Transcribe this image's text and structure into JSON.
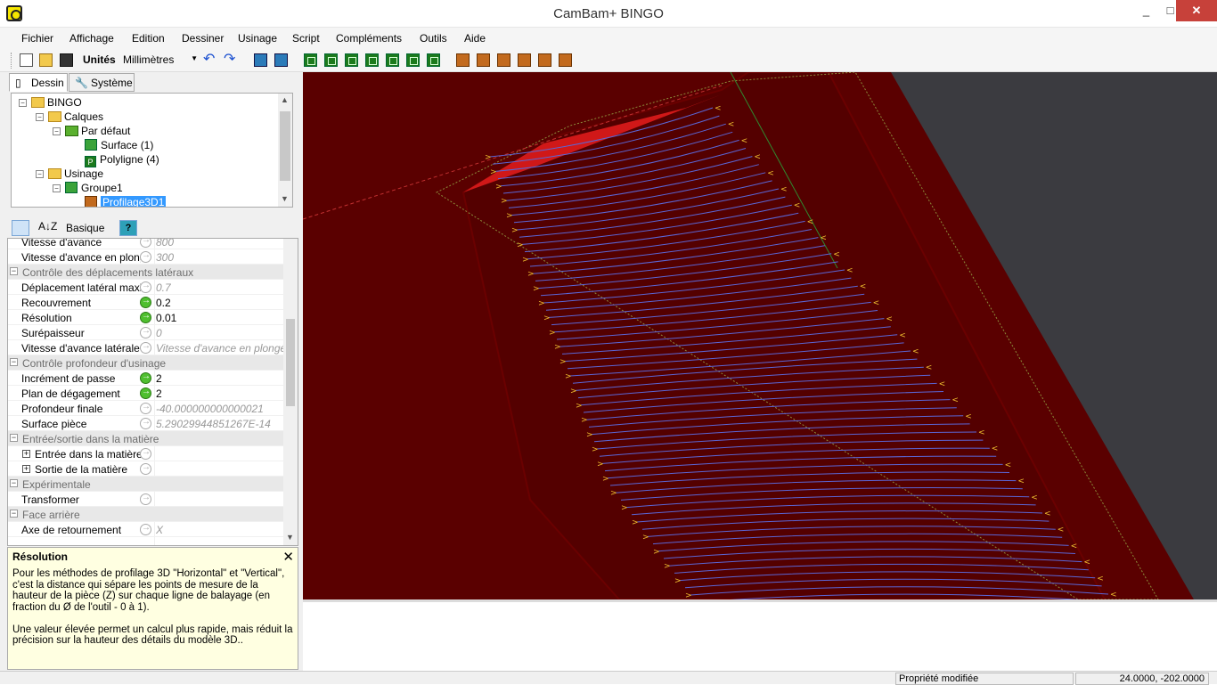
{
  "window": {
    "title": "CamBam+  BINGO",
    "minimize": "_",
    "maximize": "□",
    "close": "✕"
  },
  "menu": [
    "Fichier",
    "Affichage",
    "Edition",
    "Dessiner",
    "Usinage",
    "Script",
    "Compléments",
    "Outils",
    "Aide"
  ],
  "toolbar": {
    "units_label": "Unités",
    "units_value": "Millimètres",
    "icons": [
      "new-file-icon",
      "open-folder-icon",
      "save-icon",
      "undo-icon",
      "redo-icon",
      "snap-icon",
      "grid-icon",
      "profile-icon",
      "pocket-icon",
      "drill-icon",
      "engrave-icon",
      "text-icon",
      "lathe-icon",
      "3d-profile-icon",
      "gcode-icon",
      "style-icon",
      "script-icon",
      "export-icon",
      "post-icon"
    ]
  },
  "tabs": {
    "drawing": "Dessin",
    "system": "Système"
  },
  "tree": {
    "root": "BINGO",
    "layers": "Calques",
    "default_layer": "Par défaut",
    "surface": "Surface (1)",
    "polyline": "Polyligne (4)",
    "machining": "Usinage",
    "group": "Groupe1",
    "selected": "Profilage3D1"
  },
  "props_toolbar": {
    "basic_label": "Basique",
    "help_label": "?"
  },
  "properties": [
    {
      "type": "prop",
      "name": "Vitesse d'avance",
      "value": "800",
      "active": false
    },
    {
      "type": "prop",
      "name": "Vitesse d'avance en plongée",
      "value": "300",
      "active": false
    },
    {
      "type": "cat",
      "name": "Contrôle des déplacements latéraux"
    },
    {
      "type": "prop",
      "name": "Déplacement latéral maxi",
      "value": "0.7",
      "active": false
    },
    {
      "type": "prop",
      "name": "Recouvrement",
      "value": "0.2",
      "active": true
    },
    {
      "type": "prop",
      "name": "Résolution",
      "value": "0.01",
      "active": true
    },
    {
      "type": "prop",
      "name": "Surépaisseur",
      "value": "0",
      "active": false
    },
    {
      "type": "prop",
      "name": "Vitesse d'avance latérale",
      "value": "Vitesse d'avance en plongée",
      "active": false
    },
    {
      "type": "cat",
      "name": "Contrôle profondeur d'usinage"
    },
    {
      "type": "prop",
      "name": "Incrément de passe",
      "value": "2",
      "active": true
    },
    {
      "type": "prop",
      "name": "Plan de dégagement",
      "value": "2",
      "active": true
    },
    {
      "type": "prop",
      "name": "Profondeur finale",
      "value": "-40.000000000000021",
      "active": false
    },
    {
      "type": "prop",
      "name": "Surface pièce",
      "value": "5.29029944851267E-14",
      "active": false
    },
    {
      "type": "cat",
      "name": "Entrée/sortie dans la matière"
    },
    {
      "type": "sub",
      "name": "Entrée dans la matière",
      "value": "",
      "active": false
    },
    {
      "type": "sub",
      "name": "Sortie de la matière",
      "value": "",
      "active": false
    },
    {
      "type": "cat",
      "name": "Expérimentale"
    },
    {
      "type": "prop",
      "name": "Transformer",
      "value": "",
      "active": false
    },
    {
      "type": "cat",
      "name": "Face arrière"
    },
    {
      "type": "prop",
      "name": "Axe de retournement",
      "value": "X",
      "active": false
    }
  ],
  "help": {
    "title": "Résolution",
    "body": "Pour les méthodes de profilage 3D \"Horizontal\" et \"Vertical\", c'est la distance qui sépare les points de mesure de la hauteur de la pièce (Z) sur chaque ligne de balayage (en fraction du Ø de l'outil - 0 à 1).\n\nUne valeur élevée permet un calcul plus rapide, mais réduit la précision sur la hauteur des détails du modèle 3D..",
    "close": "✕"
  },
  "status": {
    "message": "Propriété modifiée",
    "coords": "24.0000, -202.0000"
  },
  "colors": {
    "surface": "#5a0000",
    "toolpath": "#5b66d6",
    "marker": "#f0c030",
    "background": "#3b3b40"
  }
}
